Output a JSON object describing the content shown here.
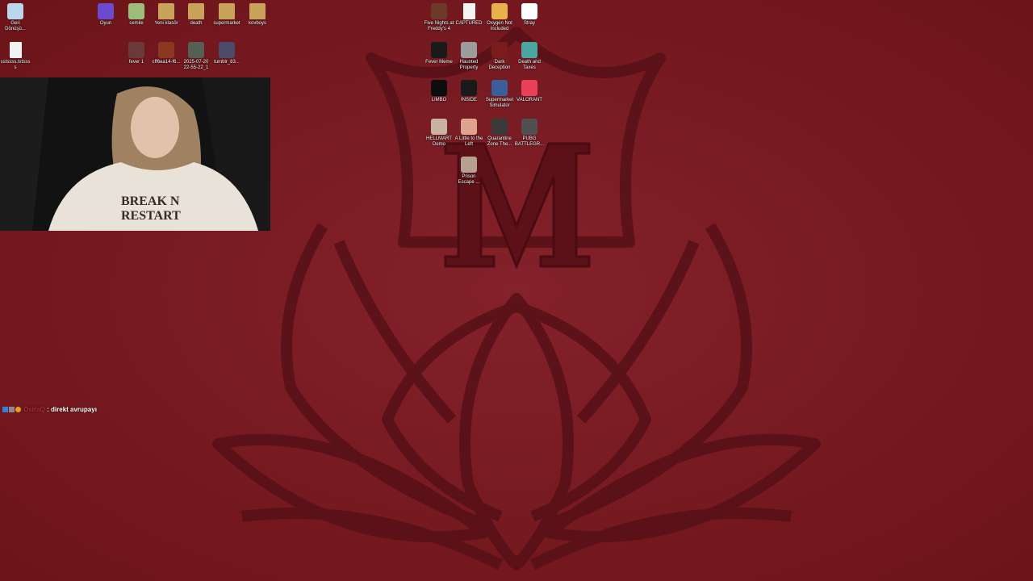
{
  "desktop": {
    "left_icons": [
      {
        "label": "Geri Dönüşü...",
        "icon": "recycle-bin-icon",
        "color": "#b9d7ee"
      },
      {
        "label": "Oyun",
        "icon": "app-icon",
        "color": "#6a4bd0"
      },
      {
        "label": "cemile",
        "icon": "device-icon",
        "color": "#9dbd7a"
      },
      {
        "label": "Yeni klasör",
        "icon": "folder-icon",
        "color": "#caa35a"
      },
      {
        "label": "death",
        "icon": "folder-icon",
        "color": "#caa35a"
      },
      {
        "label": "supermarket",
        "icon": "folder-icon",
        "color": "#caa35a"
      },
      {
        "label": "kovboys",
        "icon": "folder-icon",
        "color": "#caa35a"
      },
      {
        "label": "sstssss.txtssss",
        "icon": "text-file-icon",
        "color": "#f2f2f2"
      },
      {
        "label": "fever 1",
        "icon": "image-file-icon",
        "color": "#6a3a3a"
      },
      {
        "label": "cff6ea14-f6...",
        "icon": "image-file-icon",
        "color": "#8a3820"
      },
      {
        "label": "2025-07-20 22-55-22_1",
        "icon": "video-file-icon",
        "color": "#556055"
      },
      {
        "label": "tumblr_83...",
        "icon": "image-file-icon",
        "color": "#4c4c6a"
      }
    ],
    "game_icons": [
      {
        "label": "Five Nights at Freddy's 4",
        "icon": "game-icon",
        "color": "#6b3a2a"
      },
      {
        "label": "CAPTURED",
        "icon": "document-icon",
        "color": "#f4f4f4"
      },
      {
        "label": "Oxygen Not Included",
        "icon": "game-icon",
        "color": "#e7b24a"
      },
      {
        "label": "Stray",
        "icon": "cat-icon",
        "color": "#ffffff"
      },
      {
        "label": "Fever Meme",
        "icon": "game-icon",
        "color": "#1a1a1a"
      },
      {
        "label": "Haunted Property",
        "icon": "game-icon",
        "color": "#9c9c9c"
      },
      {
        "label": "Dark Deception",
        "icon": "game-icon",
        "color": "#7a1c1c"
      },
      {
        "label": "Death and Taxes",
        "icon": "game-icon",
        "color": "#4aa6a0"
      },
      {
        "label": "LIMBO",
        "icon": "game-icon",
        "color": "#0d0d0d"
      },
      {
        "label": "INSIDE",
        "icon": "game-icon",
        "color": "#1a1a1a"
      },
      {
        "label": "Supermarket Simulator",
        "icon": "game-icon",
        "color": "#3a5f9a"
      },
      {
        "label": "VALORANT",
        "icon": "game-icon",
        "color": "#e84057"
      },
      {
        "label": "HELLMART Demo",
        "icon": "game-icon",
        "color": "#c9b2a0"
      },
      {
        "label": "A Little to the Left",
        "icon": "game-icon",
        "color": "#e0a48e"
      },
      {
        "label": "Quarantine Zone The...",
        "icon": "game-icon",
        "color": "#3a3a3a"
      },
      {
        "label": "PUBG BATTLEGR...",
        "icon": "game-icon",
        "color": "#505050"
      },
      {
        "label": "Prison Escape ...",
        "icon": "game-icon",
        "color": "#b8a090"
      }
    ]
  },
  "webcam": {
    "shirt_text_1": "BREAK N",
    "shirt_text_2": "RESTART"
  },
  "chat": {
    "username": "OsirisQ",
    "separator": " : ",
    "message": "direkt avrupayı"
  },
  "colors": {
    "wallpaper": "#7a1a1f",
    "emblem": "#5a1016",
    "chat_user": "#c73a47"
  }
}
